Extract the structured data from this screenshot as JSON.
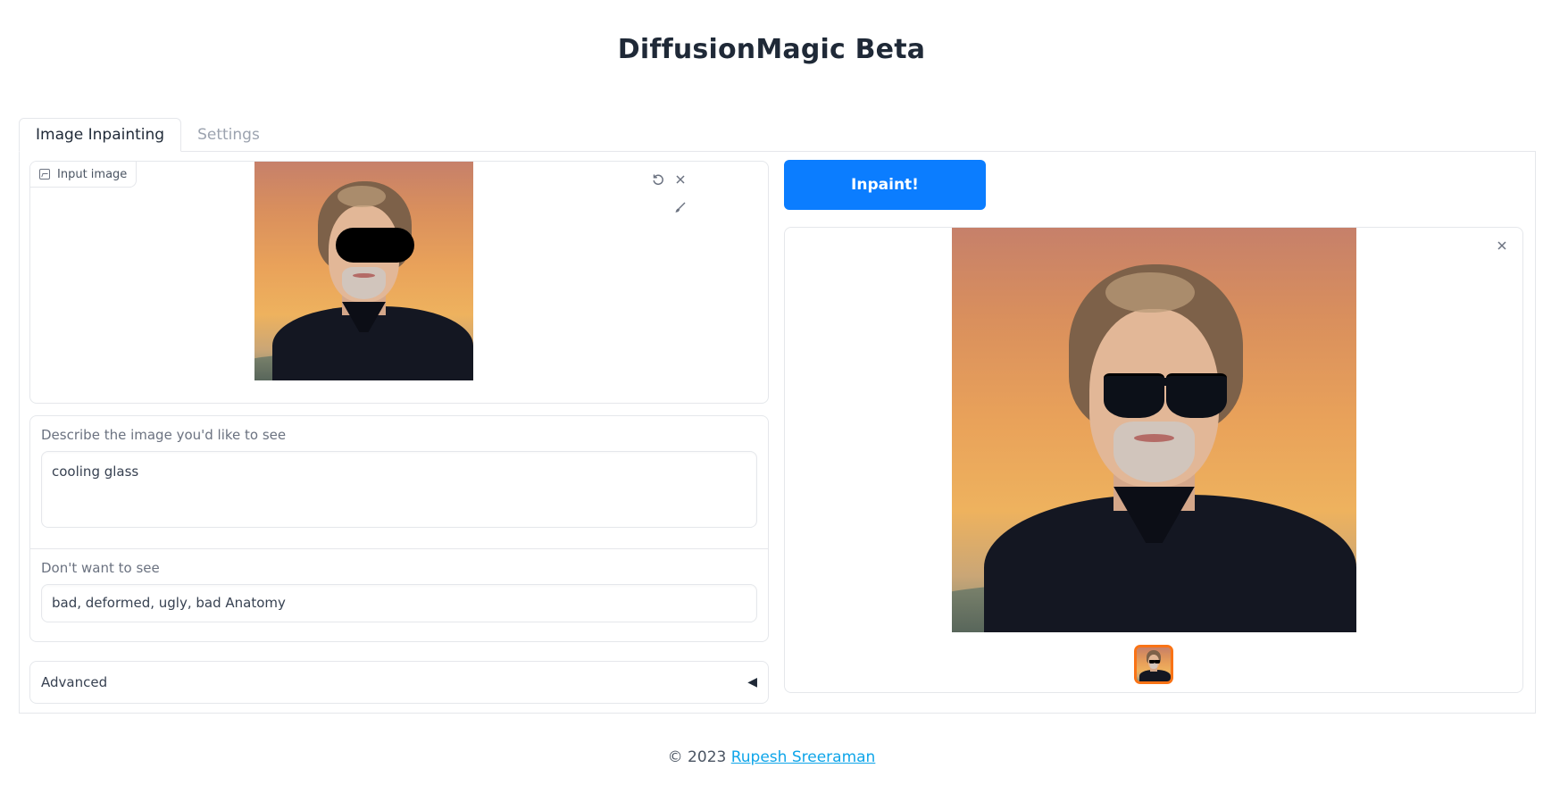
{
  "app": {
    "title": "DiffusionMagic Beta"
  },
  "tabs": [
    {
      "label": "Image Inpainting",
      "active": true
    },
    {
      "label": "Settings",
      "active": false
    }
  ],
  "input_image": {
    "label": "Input image",
    "icons": [
      "image-icon",
      "undo-icon",
      "close-icon",
      "brush-icon"
    ]
  },
  "prompt": {
    "label": "Describe the image you'd like to see",
    "value": "cooling glass"
  },
  "negative_prompt": {
    "label": "Don't want to see",
    "value": "bad, deformed, ugly, bad Anatomy"
  },
  "advanced": {
    "label": "Advanced",
    "arrow": "◀"
  },
  "action": {
    "inpaint_label": "Inpaint!"
  },
  "gallery": {
    "close_icon": "close-icon",
    "selected_thumbnail": 1,
    "thumbnail_count": 1
  },
  "footer": {
    "prefix": "© 2023 ",
    "author": "Rupesh Sreeraman"
  },
  "colors": {
    "primary_button": "#0b7dff",
    "thumbnail_selected": "#f97316",
    "link": "#0ea5e9"
  }
}
